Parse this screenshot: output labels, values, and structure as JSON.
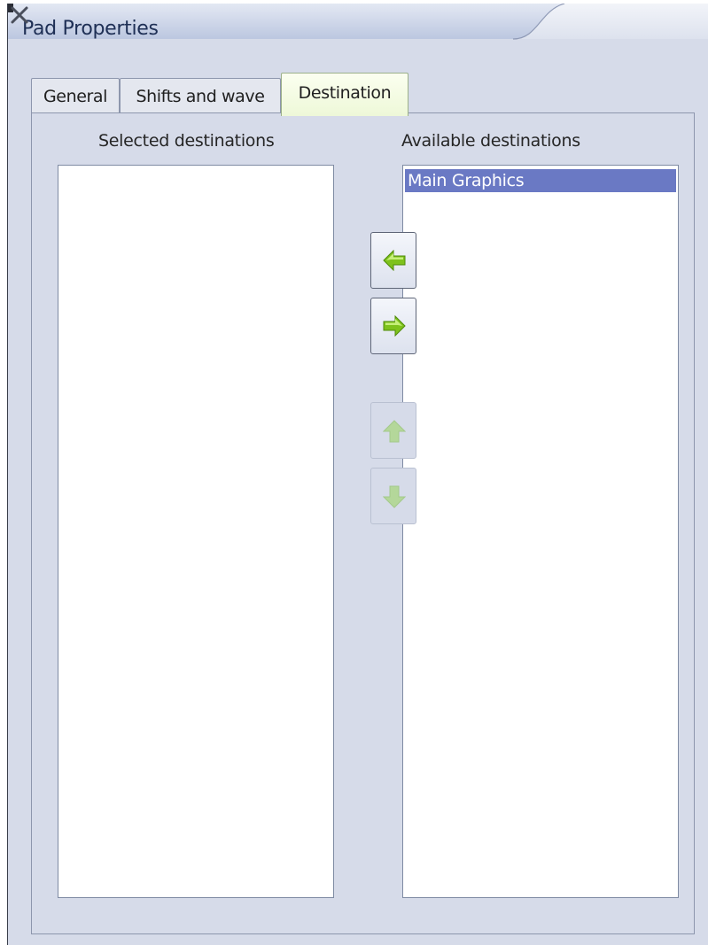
{
  "window": {
    "title": "Pad Properties",
    "close_glyph": "✕"
  },
  "tabs": [
    {
      "label": "General",
      "active": false
    },
    {
      "label": "Shifts and wave",
      "active": false
    },
    {
      "label": "Destination",
      "active": true
    }
  ],
  "destination": {
    "selected_label": "Selected destinations",
    "available_label": "Available destinations",
    "selected_items": [],
    "available_items": [
      {
        "label": "Main Graphics",
        "selected": true
      }
    ]
  },
  "buttons": {
    "add": {
      "icon": "arrow-left-icon",
      "enabled": true
    },
    "remove": {
      "icon": "arrow-right-icon",
      "enabled": true
    },
    "move_up": {
      "icon": "arrow-up-icon",
      "enabled": false
    },
    "move_down": {
      "icon": "arrow-down-icon",
      "enabled": false
    }
  },
  "colors": {
    "window_bg": "#d6dbe9",
    "selection": "#6a79c4",
    "arrow_green": "#7ec21c"
  }
}
